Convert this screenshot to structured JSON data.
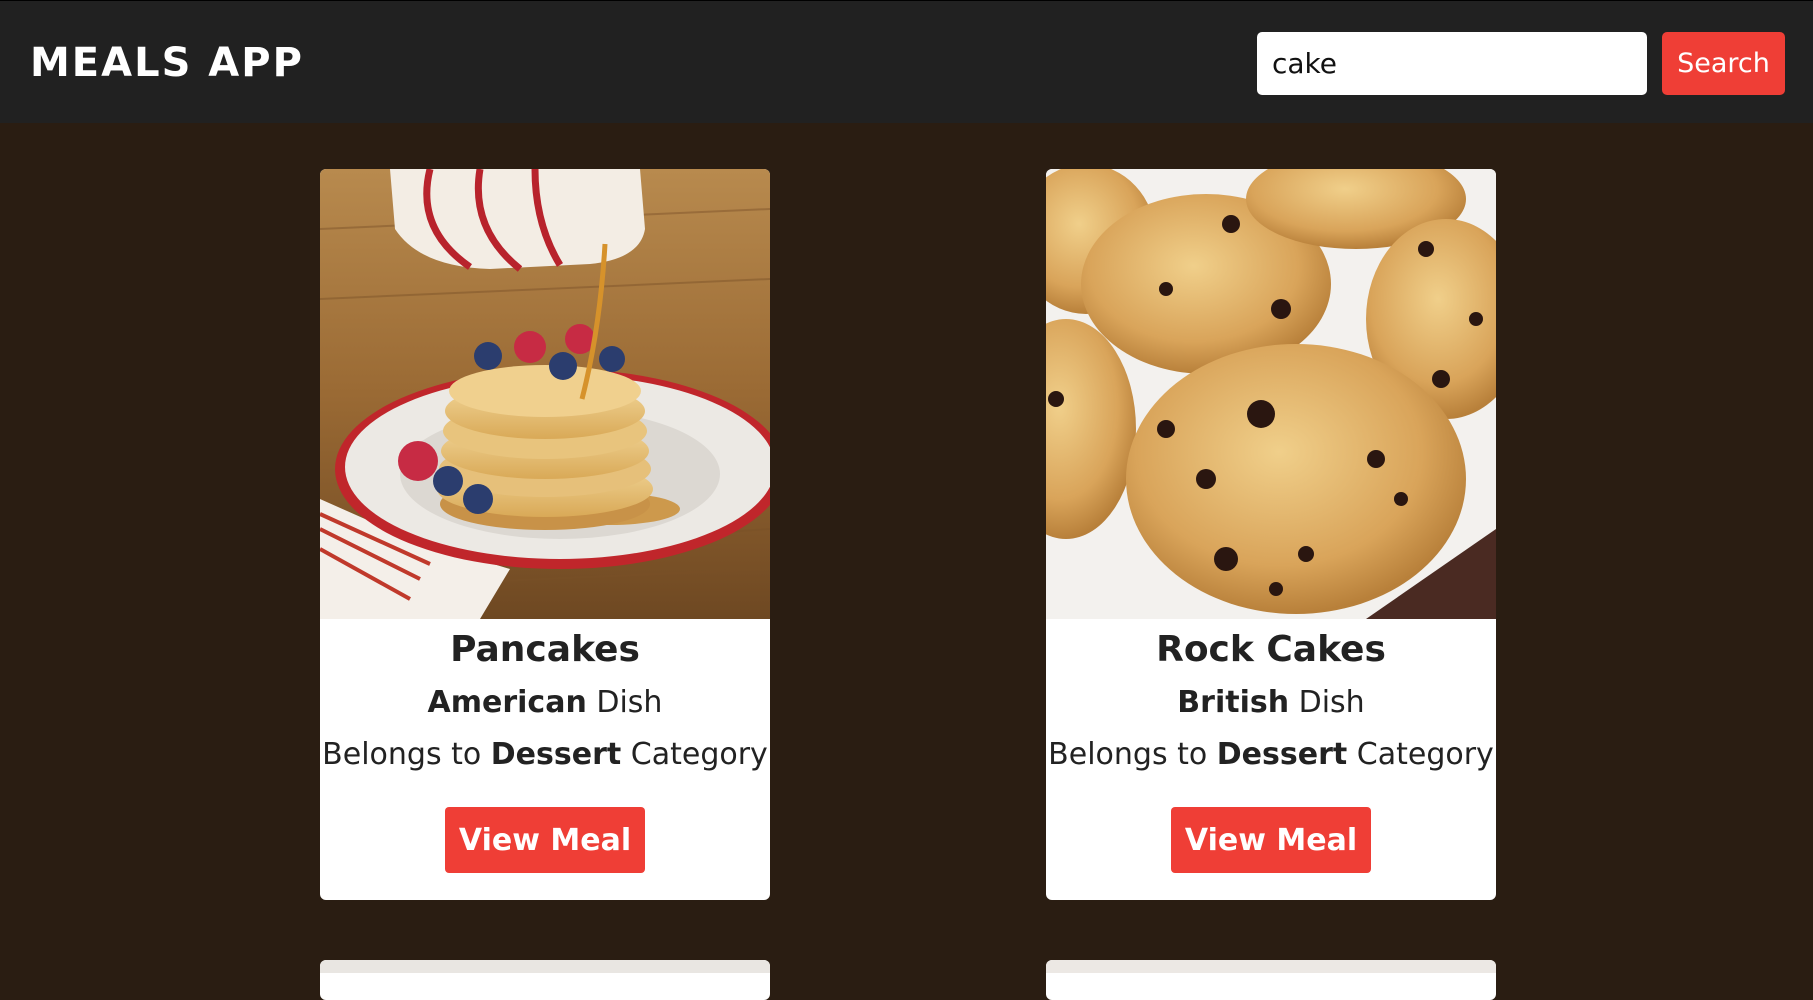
{
  "header": {
    "app_title": "MEALS APP",
    "search_value": "cake",
    "search_button_label": "Search"
  },
  "meals": [
    {
      "name": "Pancakes",
      "area": "American",
      "area_suffix": " Dish",
      "category_prefix": "Belongs to ",
      "category": "Dessert",
      "category_suffix": " Category",
      "button_label": "View Meal",
      "image_icon": "pancakes-image"
    },
    {
      "name": "Rock Cakes",
      "area": "British",
      "area_suffix": " Dish",
      "category_prefix": "Belongs to ",
      "category": "Dessert",
      "category_suffix": " Category",
      "button_label": "View Meal",
      "image_icon": "rock-cakes-image"
    }
  ],
  "colors": {
    "header_bg": "#212121",
    "page_bg": "#2a1d12",
    "accent": "#ef3e36"
  }
}
